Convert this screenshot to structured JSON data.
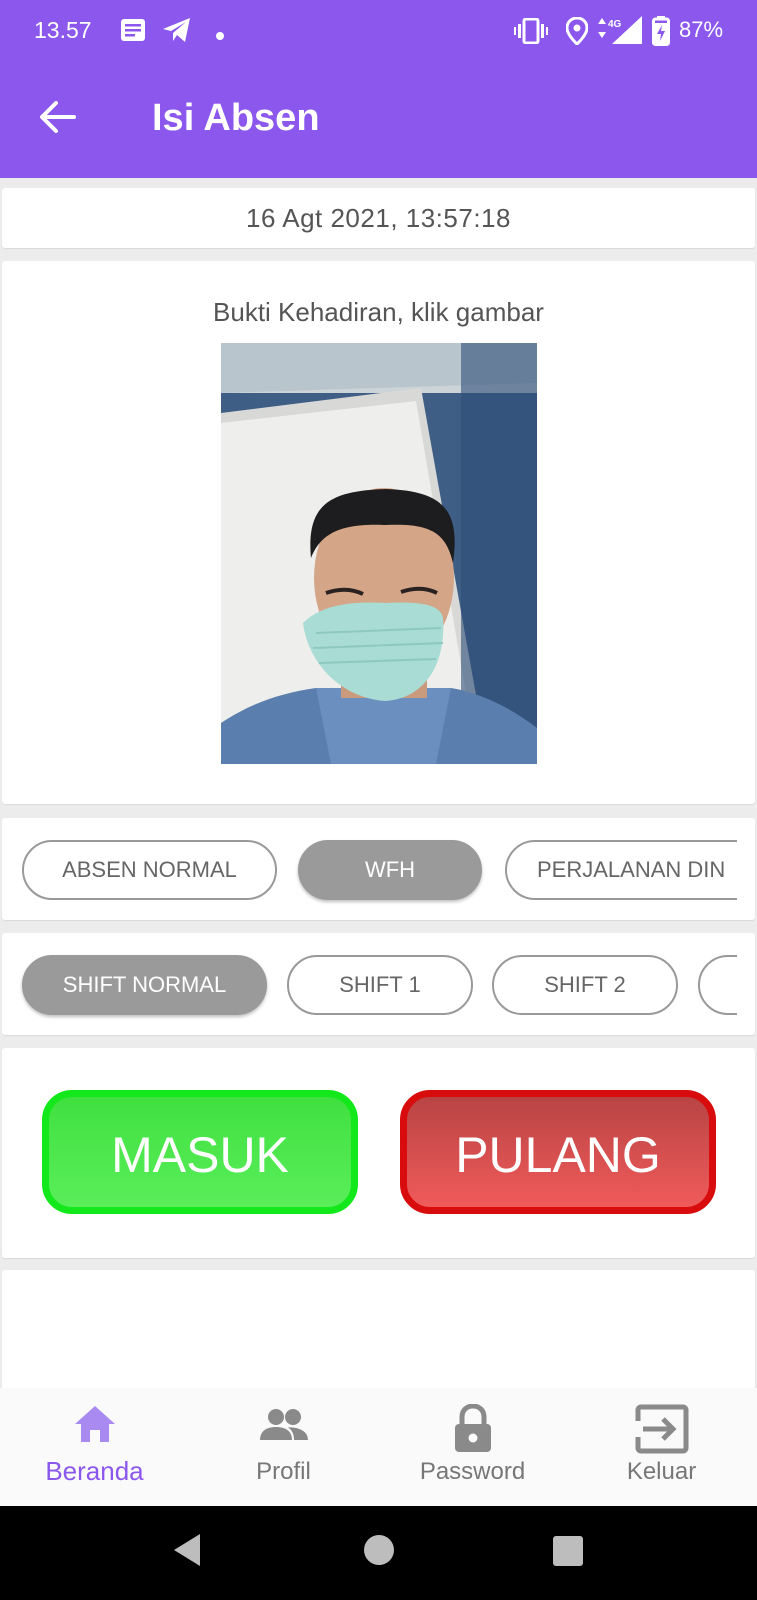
{
  "status_bar": {
    "time": "13.57",
    "battery": "87%",
    "network": "4G",
    "icons": [
      "notes-icon",
      "telegram-icon",
      "dot-icon",
      "vibrate-icon",
      "location-icon",
      "signal-icon",
      "battery-icon"
    ]
  },
  "app_bar": {
    "title": "Isi Absen"
  },
  "datetime": "16 Agt 2021, 13:57:18",
  "photo": {
    "label": "Bukti Kehadiran, klik gambar"
  },
  "attendance_types": [
    {
      "label": "ABSEN NORMAL",
      "selected": false
    },
    {
      "label": "WFH",
      "selected": true
    },
    {
      "label": "PERJALANAN DIN",
      "selected": false
    }
  ],
  "shifts": [
    {
      "label": "SHIFT NORMAL",
      "selected": true
    },
    {
      "label": "SHIFT 1",
      "selected": false
    },
    {
      "label": "SHIFT 2",
      "selected": false
    }
  ],
  "actions": {
    "masuk": "MASUK",
    "pulang": "PULANG"
  },
  "bottom_nav": [
    {
      "label": "Beranda",
      "icon": "home-icon",
      "active": true
    },
    {
      "label": "Profil",
      "icon": "people-icon",
      "active": false
    },
    {
      "label": "Password",
      "icon": "lock-icon",
      "active": false
    },
    {
      "label": "Keluar",
      "icon": "exit-icon",
      "active": false
    }
  ],
  "colors": {
    "primary": "#8b57ec",
    "masuk_border": "#12e81a",
    "pulang_border": "#d80c0c",
    "chip_selected": "#9a9a9a"
  }
}
